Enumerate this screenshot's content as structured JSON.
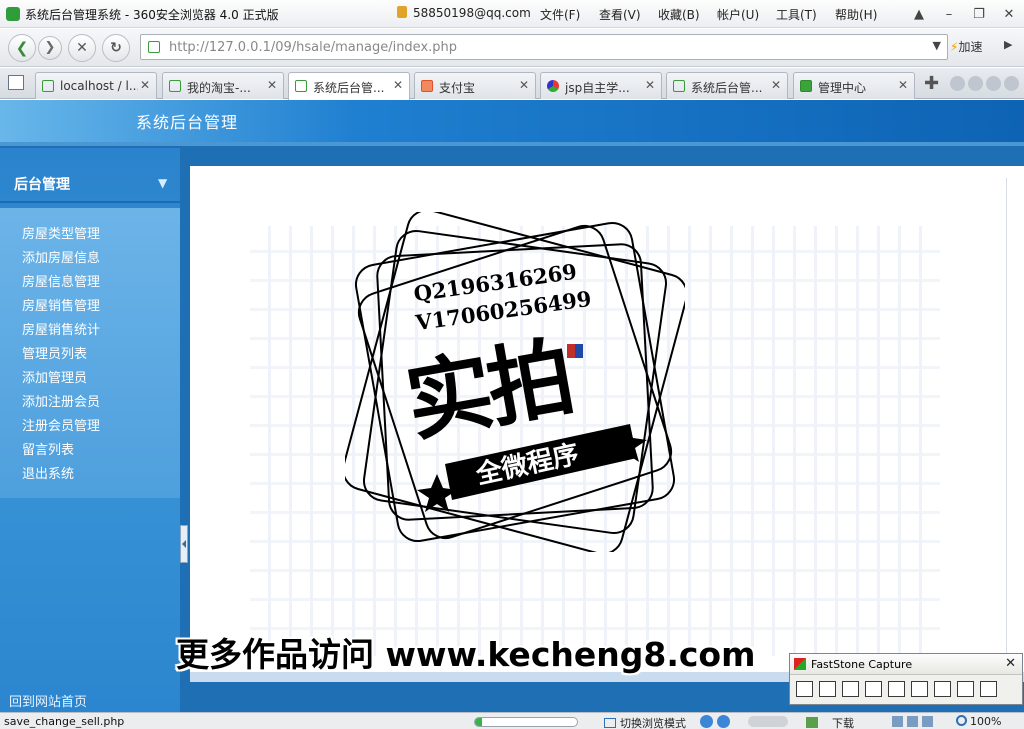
{
  "window": {
    "title": "系统后台管理系统 - 360安全浏览器 4.0 正式版",
    "account": "58850198@qq.com",
    "menu": [
      "文件(F)",
      "查看(V)",
      "收藏(B)",
      "帐户(U)",
      "工具(T)",
      "帮助(H)"
    ]
  },
  "toolbar": {
    "url": "http://127.0.0.1/09/hsale/manage/index.php",
    "accelerate_label": "加速"
  },
  "tabs": [
    {
      "label": "localhost / l...",
      "icon": "page-icon",
      "active": false
    },
    {
      "label": "我的淘宝-...",
      "icon": "page-icon",
      "active": false
    },
    {
      "label": "系统后台管...",
      "icon": "page-icon",
      "active": true
    },
    {
      "label": "支付宝",
      "icon": "alipay-icon",
      "active": false
    },
    {
      "label": "jsp自主学...",
      "icon": "search-engine-icon",
      "active": false
    },
    {
      "label": "系统后台管...",
      "icon": "page-icon",
      "active": false
    },
    {
      "label": "管理中心",
      "icon": "site-361-icon",
      "active": false
    }
  ],
  "page": {
    "header_title": "系统后台管理",
    "sidebar_title": "后台管理",
    "menu_items": [
      "房屋类型管理",
      "添加房屋信息",
      "房屋信息管理",
      "房屋销售管理",
      "房屋销售统计",
      "管理员列表",
      "添加管理员",
      "添加注册会员",
      "注册会员管理",
      "留言列表",
      "退出系统"
    ],
    "home_link": "回到网站首页"
  },
  "watermark": {
    "qq": "Q2196316269",
    "wechat": "V17060256499",
    "stamp_main": "实拍",
    "stamp_ribbon": "全微程序",
    "bottom_text": "更多作品访问 www.kecheng8.com"
  },
  "faststone": {
    "title": "FastStone Capture"
  },
  "statusbar": {
    "text": "save_change_sell.php",
    "progress": 0.07,
    "mode_label": "切换浏览模式",
    "download_label": "下载",
    "zoom": "100%"
  },
  "colors": {
    "page_blue": "#1f6fb5",
    "sidebar_panel": "#6cb4e8",
    "accent_green": "#36b34a"
  }
}
